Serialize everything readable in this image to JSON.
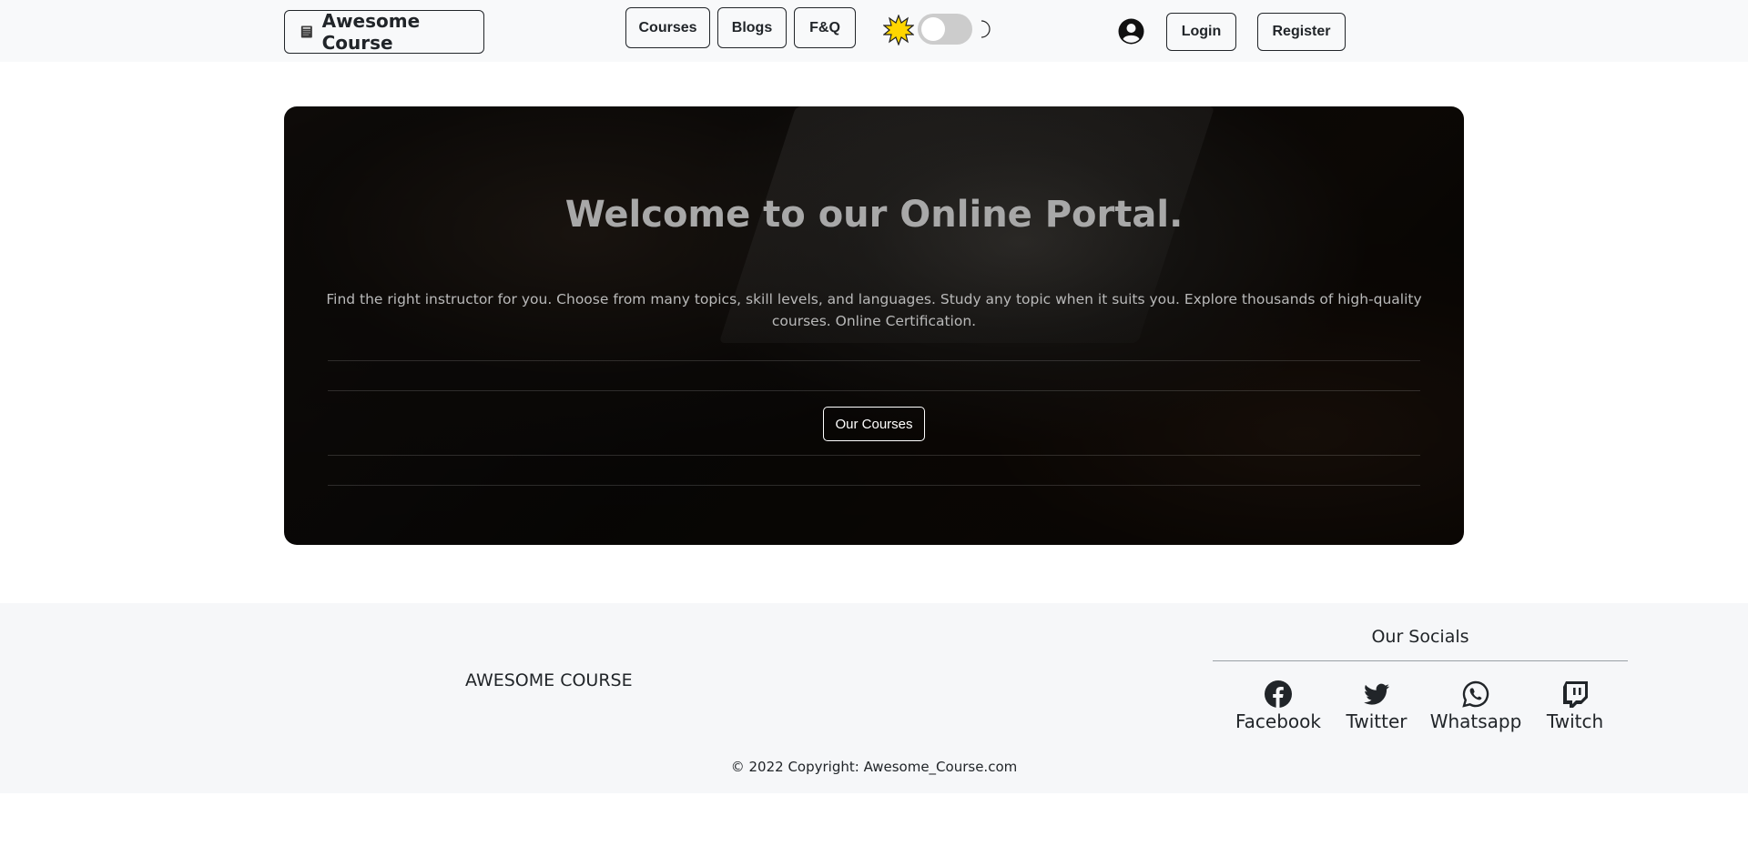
{
  "navbar": {
    "brand_label": "Awesome Course",
    "brand_icon": "book-icon",
    "links": [
      {
        "label": "Courses"
      },
      {
        "label": "Blogs"
      },
      {
        "label": "F&Q"
      }
    ],
    "theme_toggle": {
      "sun_icon": "sun-icon",
      "moon_icon": "moon-icon",
      "state": "light"
    },
    "user_icon": "user-circle-icon",
    "login_label": "Login",
    "register_label": "Register"
  },
  "hero": {
    "title": "Welcome to our Online Portal.",
    "lead": "Find the right instructor for you. Choose from many topics, skill levels, and languages. Study any topic when it suits you. Explore thousands of high-quality courses. Online Certification.",
    "cta_label": "Our Courses"
  },
  "footer": {
    "brand_name": "AWESOME COURSE",
    "socials_title": "Our Socials",
    "socials": [
      {
        "label": "Facebook",
        "icon": "facebook-icon"
      },
      {
        "label": "Twitter",
        "icon": "twitter-icon"
      },
      {
        "label": "Whatsapp",
        "icon": "whatsapp-icon"
      },
      {
        "label": "Twitch",
        "icon": "twitch-icon"
      }
    ],
    "copyright": "© 2022 Copyright: Awesome_Course.com"
  },
  "colors": {
    "navbar_bg": "#f8f9fa",
    "text_dark": "#212529",
    "footer_bg": "#f6f7f9",
    "toggle_track": "#cccccc",
    "sun_fill": "#ffd600"
  }
}
